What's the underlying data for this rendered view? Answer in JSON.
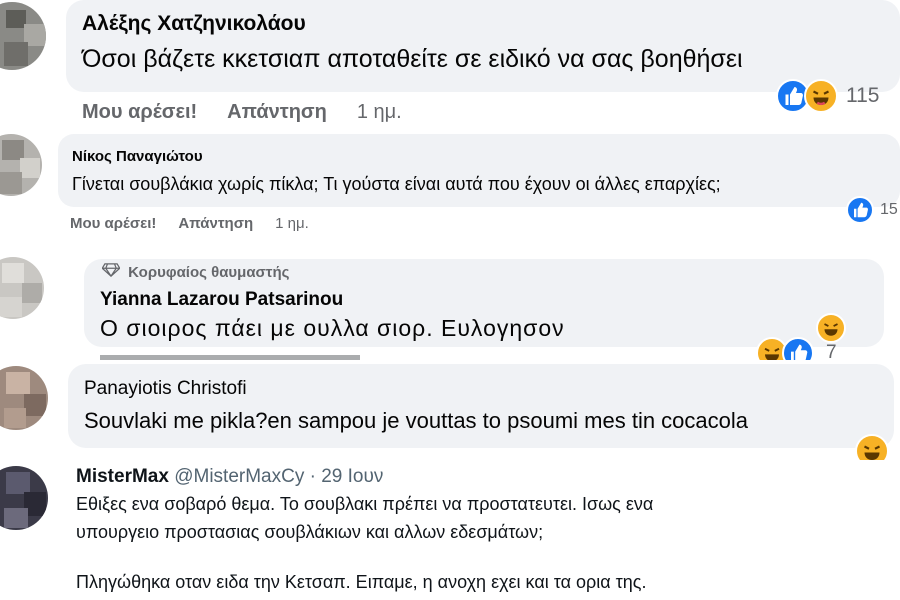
{
  "comments": [
    {
      "author": "Αλέξης Χατζηνικολάου",
      "text": "Όσοι βάζετε κκετσιαπ αποταθείτε σε ειδικό να σας βοηθήσει",
      "like_label": "Μου αρέσει!",
      "reply_label": "Απάντηση",
      "time": "1 ημ.",
      "reaction_count": "115"
    },
    {
      "author": "Νίκος Παναγιώτου",
      "text": "Γίνεται σουβλάκια χωρίς πίκλα; Τι γούστα είναι αυτά που έχουν οι άλλες επαρχίες;",
      "like_label": "Μου αρέσει!",
      "reply_label": "Απάντηση",
      "time": "1 ημ.",
      "reaction_count": "15"
    },
    {
      "badge": "Κορυφαίος θαυμαστής",
      "author": "Yianna Lazarou Patsarinou",
      "text": "Ο σιοιρος πάει με ουλλα σιορ. Ευλογησον",
      "reaction_count": "7"
    },
    {
      "author": "Panayiotis Christofi",
      "text": "Souvlaki me pikla?en sampou je vouttas to psoumi mes tin cocacola"
    }
  ],
  "tweet": {
    "author": "MisterMax",
    "handle": "@MisterMaxCy",
    "separator": "·",
    "date": "29 Ιουν",
    "lines": [
      "Εθιξες ενα σοβαρό θεμα. Το σουβλακι πρέπει να προστατευτει. Ισως ενα",
      "υπουργειο προστασιας σουβλάκιων και αλλων εδεσμάτων;",
      "Πληγώθηκα οταν ειδα την Κετσαπ. Ειπαμε, η ανοχη εχει και τα ορια της."
    ]
  },
  "colors": {
    "bubble": "#f0f2f5",
    "like_blue": "#1877f2",
    "haha_yellow": "#f7b125",
    "meta_grey": "#65676b"
  },
  "icons": [
    "like-icon",
    "haha-icon",
    "diamond-icon"
  ]
}
